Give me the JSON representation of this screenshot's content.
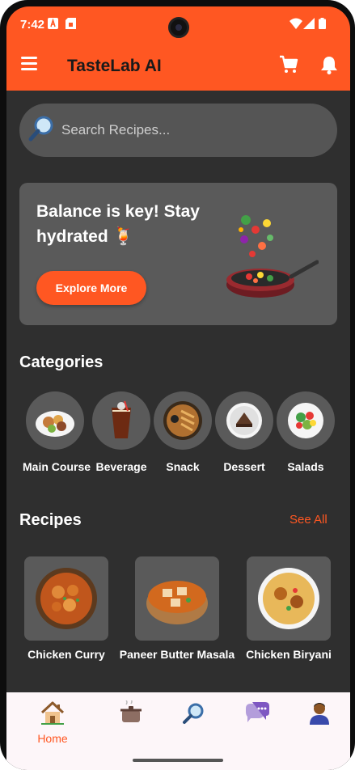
{
  "status_bar": {
    "time": "7:42"
  },
  "app_bar": {
    "title": "TasteLab AI"
  },
  "search": {
    "placeholder": "Search Recipes..."
  },
  "promo": {
    "headline": "Balance is key! Stay hydrated 🍹",
    "button_label": "Explore More"
  },
  "categories": {
    "title": "Categories",
    "items": [
      {
        "label": "Main Course",
        "icon": "main-course-icon"
      },
      {
        "label": "Beverage",
        "icon": "beverage-icon"
      },
      {
        "label": "Snack",
        "icon": "snack-icon"
      },
      {
        "label": "Dessert",
        "icon": "dessert-icon"
      },
      {
        "label": "Salads",
        "icon": "salad-icon"
      }
    ]
  },
  "recipes": {
    "title": "Recipes",
    "see_all_label": "See All",
    "items": [
      {
        "label": "Chicken Curry"
      },
      {
        "label": "Paneer Butter Masala"
      },
      {
        "label": "Chicken Biryani"
      }
    ]
  },
  "bottom_nav": {
    "items": [
      {
        "label": "Home",
        "icon": "home-icon",
        "active": true
      },
      {
        "label": "",
        "icon": "cooking-pot-icon"
      },
      {
        "label": "",
        "icon": "search-icon"
      },
      {
        "label": "",
        "icon": "chat-icon"
      },
      {
        "label": "",
        "icon": "profile-icon"
      }
    ]
  },
  "colors": {
    "accent": "#ff5722",
    "background": "#2f2f2f",
    "card": "#5a5a5a",
    "nav_background": "#fdf6f9"
  }
}
